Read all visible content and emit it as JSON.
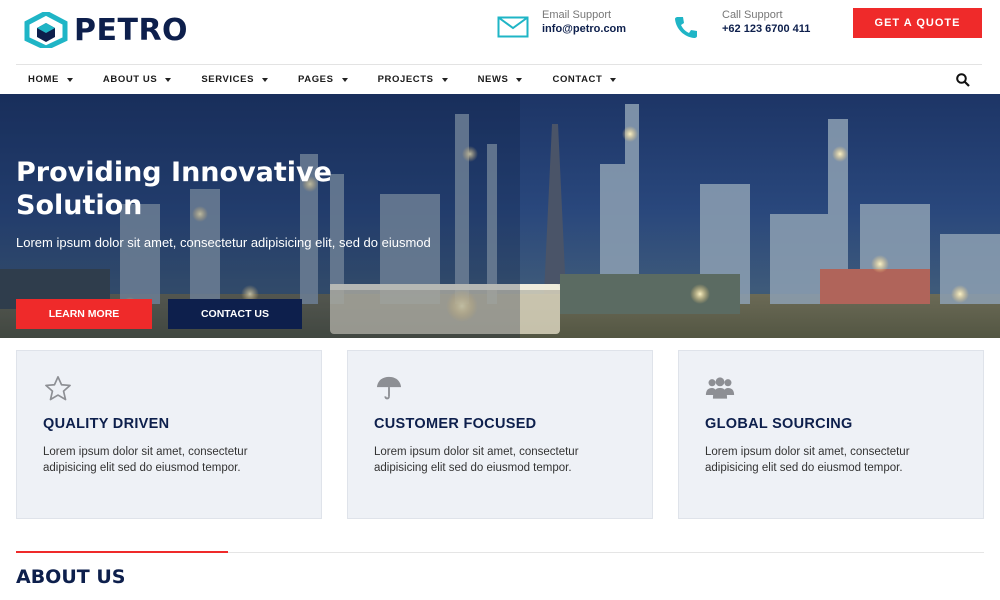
{
  "brand": {
    "name": "PETRO",
    "logo_icon": "hexagon-cube-icon"
  },
  "header": {
    "email": {
      "label": "Email Support",
      "value": "info@petro.com",
      "icon": "mail-icon"
    },
    "call": {
      "label": "Call Support",
      "value": "+62 123 6700 411",
      "icon": "phone-icon"
    },
    "quote_button": "GET A QUOTE"
  },
  "nav": {
    "items": [
      {
        "label": "HOME"
      },
      {
        "label": "ABOUT US"
      },
      {
        "label": "SERVICES"
      },
      {
        "label": "PAGES"
      },
      {
        "label": "PROJECTS"
      },
      {
        "label": "NEWS"
      },
      {
        "label": "CONTACT"
      }
    ],
    "search_icon": "search-icon"
  },
  "hero": {
    "title": "Providing Innovative Solution",
    "subtitle": "Lorem ipsum dolor sit amet, consectetur adipisicing elit, sed do eiusmod",
    "learn_more": "LEARN MORE",
    "contact_us": "CONTACT US"
  },
  "features": [
    {
      "title": "QUALITY DRIVEN",
      "text": "Lorem ipsum dolor sit amet, consectetur adipisicing elit sed do eiusmod tempor.",
      "icon": "star-icon"
    },
    {
      "title": "CUSTOMER FOCUSED",
      "text": "Lorem ipsum dolor sit amet, consectetur adipisicing elit sed do eiusmod tempor.",
      "icon": "umbrella-icon"
    },
    {
      "title": "GLOBAL SOURCING",
      "text": "Lorem ipsum dolor sit amet, consectetur adipisicing elit sed do eiusmod tempor.",
      "icon": "users-icon"
    }
  ],
  "about": {
    "title": "ABOUT US"
  },
  "colors": {
    "primary": "#0d1f4c",
    "accent": "#ef2a2a",
    "teal": "#1fb5c6"
  }
}
